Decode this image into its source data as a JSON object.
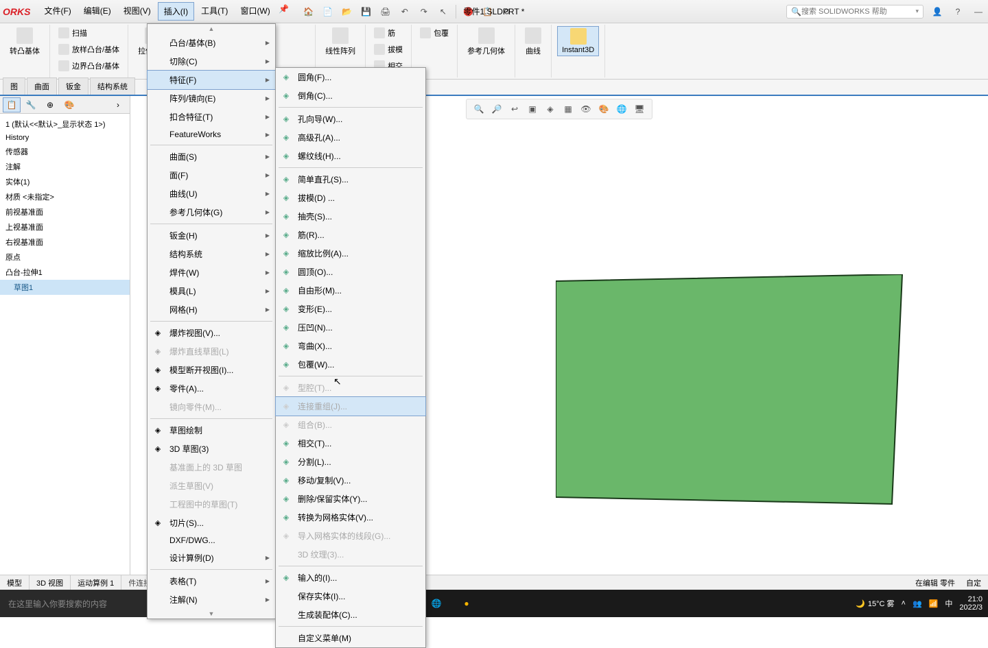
{
  "app": {
    "logo": "ORKS",
    "docTitle": "零件1.SLDPRT *"
  },
  "menubar": {
    "items": [
      "文件(F)",
      "编辑(E)",
      "视图(V)",
      "插入(I)",
      "工具(T)",
      "窗口(W)"
    ],
    "activeIndex": 3
  },
  "searchPlaceholder": "搜索 SOLIDWORKS 帮助",
  "ribbon": {
    "rotBoss": "转凸基体",
    "sweep": "扫描",
    "loft": "放样凸台/基体",
    "boundary": "边界凸台/基体",
    "extrudeCut": "拉伸切除",
    "linPattern": "线性阵列",
    "rib": "筋",
    "draft": "拔模",
    "intersect": "相交",
    "wrap": "包覆",
    "refGeom": "参考几何体",
    "curves": "曲线",
    "instant3d": "Instant3D"
  },
  "tabs": [
    "图",
    "曲面",
    "钣金",
    "结构系统"
  ],
  "tree": {
    "root": "1 (默认<<默认>_显示状态 1>)",
    "nodes": [
      "History",
      "传感器",
      "注解",
      "实体(1)",
      "材质 <未指定>",
      "前视基准面",
      "上视基准面",
      "右视基准面",
      "原点",
      "凸台-拉伸1",
      "草图1"
    ],
    "selectedIndex": 10
  },
  "insertMenu": {
    "items": [
      {
        "label": "凸台/基体(B)",
        "sub": true
      },
      {
        "label": "切除(C)",
        "sub": true
      },
      {
        "label": "特征(F)",
        "sub": true,
        "highlighted": true
      },
      {
        "label": "阵列/镜向(E)",
        "sub": true
      },
      {
        "label": "扣合特征(T)",
        "sub": true
      },
      {
        "label": "FeatureWorks",
        "sub": true
      },
      {
        "sep": true
      },
      {
        "label": "曲面(S)",
        "sub": true
      },
      {
        "label": "面(F)",
        "sub": true
      },
      {
        "label": "曲线(U)",
        "sub": true
      },
      {
        "label": "参考几何体(G)",
        "sub": true
      },
      {
        "sep": true
      },
      {
        "label": "钣金(H)",
        "sub": true
      },
      {
        "label": "结构系统",
        "sub": true
      },
      {
        "label": "焊件(W)",
        "sub": true
      },
      {
        "label": "模具(L)",
        "sub": true
      },
      {
        "label": "网格(H)",
        "sub": true
      },
      {
        "sep": true
      },
      {
        "label": "爆炸视图(V)...",
        "icon": true
      },
      {
        "label": "爆炸直线草图(L)",
        "icon": true,
        "disabled": true
      },
      {
        "label": "模型断开视图(I)...",
        "icon": true
      },
      {
        "label": "零件(A)...",
        "icon": true
      },
      {
        "label": "镜向零件(M)...",
        "disabled": true
      },
      {
        "sep": true
      },
      {
        "label": "草图绘制",
        "icon": true
      },
      {
        "label": "3D 草图(3)",
        "icon": true
      },
      {
        "label": "基准面上的 3D 草图",
        "disabled": true
      },
      {
        "label": "派生草图(V)",
        "disabled": true
      },
      {
        "label": "工程图中的草图(T)",
        "disabled": true
      },
      {
        "label": "切片(S)...",
        "icon": true
      },
      {
        "label": "DXF/DWG..."
      },
      {
        "label": "设计算例(D)",
        "sub": true
      },
      {
        "sep": true
      },
      {
        "label": "表格(T)",
        "sub": true
      },
      {
        "label": "注解(N)",
        "sub": true
      }
    ]
  },
  "featureMenu": {
    "items": [
      {
        "label": "圆角(F)...",
        "icon": true
      },
      {
        "label": "倒角(C)...",
        "icon": true
      },
      {
        "sep": true
      },
      {
        "label": "孔向导(W)...",
        "icon": true
      },
      {
        "label": "高级孔(A)...",
        "icon": true
      },
      {
        "label": "螺纹线(H)...",
        "icon": true
      },
      {
        "sep": true
      },
      {
        "label": "简单直孔(S)...",
        "icon": true
      },
      {
        "label": "拔模(D) ...",
        "icon": true
      },
      {
        "label": "抽壳(S)...",
        "icon": true
      },
      {
        "label": "筋(R)...",
        "icon": true
      },
      {
        "label": "缩放比例(A)...",
        "icon": true
      },
      {
        "label": "圆顶(O)...",
        "icon": true
      },
      {
        "label": "自由形(M)...",
        "icon": true
      },
      {
        "label": "变形(E)...",
        "icon": true
      },
      {
        "label": "压凹(N)...",
        "icon": true
      },
      {
        "label": "弯曲(X)...",
        "icon": true
      },
      {
        "label": "包覆(W)...",
        "icon": true
      },
      {
        "sep": true
      },
      {
        "label": "型腔(T)...",
        "icon": true,
        "disabled": true
      },
      {
        "label": "连接重组(J)...",
        "icon": true,
        "disabled": true,
        "highlighted": true
      },
      {
        "label": "组合(B)...",
        "icon": true,
        "disabled": true
      },
      {
        "label": "相交(T)...",
        "icon": true
      },
      {
        "label": "分割(L)...",
        "icon": true
      },
      {
        "label": "移动/复制(V)...",
        "icon": true
      },
      {
        "label": "删除/保留实体(Y)...",
        "icon": true
      },
      {
        "label": "转换为网格实体(V)...",
        "icon": true
      },
      {
        "label": "导入网格实体的线段(G)...",
        "icon": true,
        "disabled": true
      },
      {
        "label": "3D 纹理(3)...",
        "disabled": true
      },
      {
        "sep": true
      },
      {
        "label": "输入的(I)...",
        "icon": true
      },
      {
        "label": "保存实体(I)..."
      },
      {
        "label": "生成装配体(C)..."
      },
      {
        "sep": true
      },
      {
        "label": "自定义菜单(M)"
      }
    ]
  },
  "bottomTabs": [
    "模型",
    "3D 视图",
    "运动算例 1"
  ],
  "statusBar": {
    "left": "件连接实体为关联装配体中的单一零件。",
    "right1": "在编辑 零件",
    "right2": "自定"
  },
  "taskbar": {
    "search": "在这里输入你要搜索的内容",
    "weather": "15°C  雾",
    "ime": "中",
    "time": "21:0",
    "date": "2022/3"
  }
}
